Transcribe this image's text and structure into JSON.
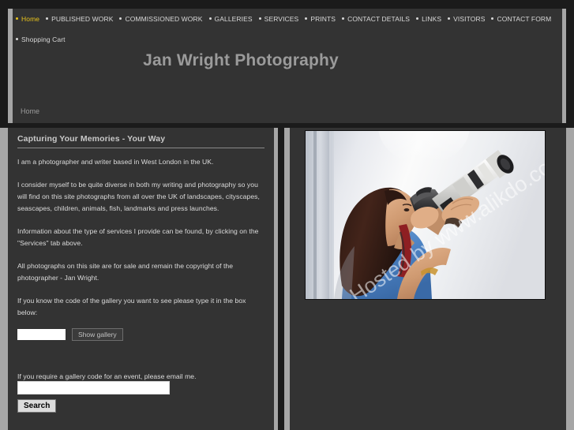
{
  "site": {
    "title": "Jan Wright Photography",
    "breadcrumb": "Home"
  },
  "nav": {
    "primary": [
      {
        "label": "Home",
        "active": true
      },
      {
        "label": "PUBLISHED WORK",
        "active": false
      },
      {
        "label": "COMMISSIONED WORK",
        "active": false
      },
      {
        "label": "GALLERIES",
        "active": false
      },
      {
        "label": "SERVICES",
        "active": false
      },
      {
        "label": "PRINTS",
        "active": false
      },
      {
        "label": "CONTACT DETAILS",
        "active": false
      },
      {
        "label": "LINKS",
        "active": false
      },
      {
        "label": "VISITORS",
        "active": false
      },
      {
        "label": "CONTACT FORM",
        "active": false
      }
    ],
    "secondary": [
      {
        "label": "Shopping Cart",
        "active": false
      }
    ]
  },
  "content": {
    "heading": "Capturing Your Memories - Your Way",
    "paragraphs": [
      "I am a photographer and writer based in West London in the UK.",
      "I consider myself to be quite diverse in both my writing and photography so you will find on this site photographs from all over the UK of landscapes, cityscapes, seascapes, children, animals, fish, landmarks and press launches.",
      "Information about the type of services I provide can be found, by clicking on the \"Services\" tab above.",
      "All photographs on this site are for sale and remain the copyright of the photographer - Jan Wright.",
      "If you know the code of the gallery you want to see please type it in the box below:"
    ],
    "gallery_note": "If you require a gallery code for an event, please email me."
  },
  "gallery_form": {
    "code_value": "",
    "code_placeholder": "",
    "button_label": "Show gallery"
  },
  "search": {
    "value": "",
    "placeholder": "",
    "button_label": "Search"
  },
  "photo": {
    "alt": "Photographer holding a DSLR camera with a white telephoto lens",
    "watermark": "Hosted by www.alikdo.com"
  },
  "colors": {
    "page_background": "#1b1b1b",
    "panel": "#333333",
    "panel_border": "#a6a6a6",
    "text": "#dcdcdc",
    "heading": "#c9c9c9",
    "active_link": "#e8c31c"
  }
}
